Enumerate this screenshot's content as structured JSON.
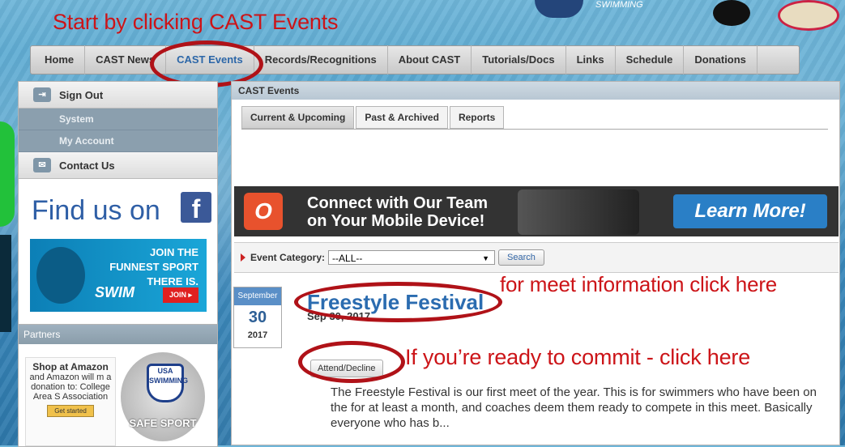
{
  "annotations": {
    "start": "Start by clicking CAST Events",
    "meet_info": "for meet information click here",
    "commit": "If you’re ready to commit - click here"
  },
  "nav": {
    "items": [
      "Home",
      "CAST News",
      "CAST Events",
      "Records/Recognitions",
      "About CAST",
      "Tutorials/Docs",
      "Links",
      "Schedule",
      "Donations"
    ]
  },
  "sidebar": {
    "sign_out": "Sign Out",
    "system": "System",
    "my_account": "My Account",
    "contact_us": "Contact Us",
    "find_us": "Find us on",
    "fb": "f",
    "swim_ad": {
      "tagline": "JOIN THE FUNNEST SPORT THERE IS.",
      "logo": "SWIM",
      "join": "JOIN ▸"
    }
  },
  "partners": {
    "title": "Partners",
    "amazon_title": "Shop at Amazon",
    "amazon_text": "and Amazon will m a donation to: College Area S Association",
    "amazon_btn": "Get started",
    "usa_text": "USA SWIMMING",
    "safe_sport": "SAFE SPORT"
  },
  "main": {
    "header": "CAST Events",
    "tabs": [
      "Current & Upcoming",
      "Past & Archived",
      "Reports"
    ],
    "banner": {
      "logo_letter": "O",
      "line1": "Connect with Our Team",
      "line2": "on Your Mobile Device!",
      "button": "Learn More!"
    },
    "filter": {
      "label": "Event Category:",
      "selected": "--ALL--",
      "search": "Search"
    },
    "event": {
      "month": "September",
      "day": "30",
      "year": "2017",
      "title": "Freestyle Festival",
      "date": "Sep 30, 2017",
      "attend_button": "Attend/Decline",
      "description": "The Freestyle Festival is our first meet of the year. This is for swimmers who have been on the for at least a month, and coaches deem them ready to compete in this meet. Basically everyone who has b..."
    }
  },
  "colors": {
    "annotation": "#cc1418",
    "link_blue": "#2b6cb0",
    "nav_active": "#2d67a8"
  }
}
